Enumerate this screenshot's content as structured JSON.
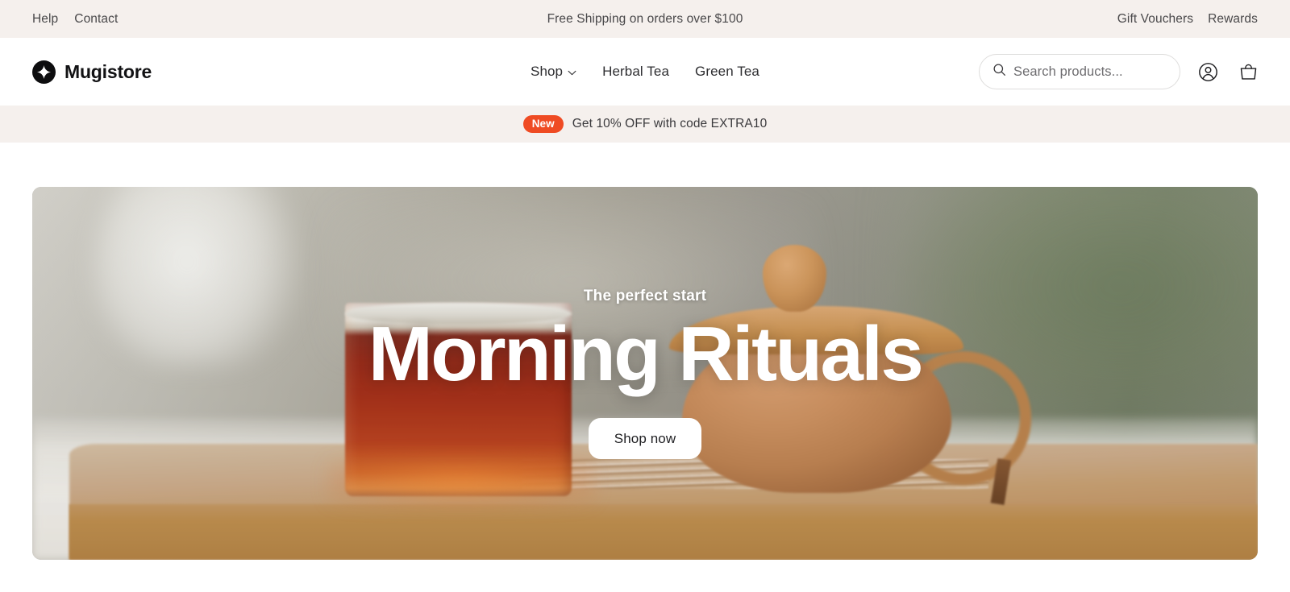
{
  "topbar": {
    "links": [
      {
        "label": "Help",
        "name": "help"
      },
      {
        "label": "Contact",
        "name": "contact"
      }
    ],
    "message": "Free Shipping on orders over $100",
    "right_links": [
      {
        "label": "Gift Vouchers",
        "name": "gift-vouchers"
      },
      {
        "label": "Rewards",
        "name": "rewards"
      }
    ],
    "background": "#f5f0ed"
  },
  "header": {
    "brand": {
      "name": "Mugistore",
      "logo_icon": "sparkle-icon",
      "logo_background": "#0d0d0f"
    },
    "nav": [
      {
        "label": "Shop",
        "name": "shop",
        "has_dropdown": true,
        "chevron": "⌄"
      },
      {
        "label": "Herbal Tea",
        "name": "herbal-tea",
        "has_dropdown": false
      },
      {
        "label": "Green Tea",
        "name": "green-tea",
        "has_dropdown": false
      }
    ],
    "search": {
      "icon": "search-icon",
      "placeholder": "Search products...",
      "value": ""
    },
    "icons": [
      {
        "name": "account-icon",
        "label": "Account"
      },
      {
        "name": "shopping-bag-icon",
        "label": "Cart"
      }
    ]
  },
  "promo": {
    "badge": "New",
    "badge_color": "#ef4b23",
    "text": "Get 10% OFF with code EXTRA10",
    "background": "#f5f0ed"
  },
  "hero": {
    "eyebrow": "The perfect start",
    "title": "Morning Rituals",
    "cta_label": "Shop now",
    "image_alt": "Glass of amber tea and a clay teapot on a wooden tray"
  }
}
